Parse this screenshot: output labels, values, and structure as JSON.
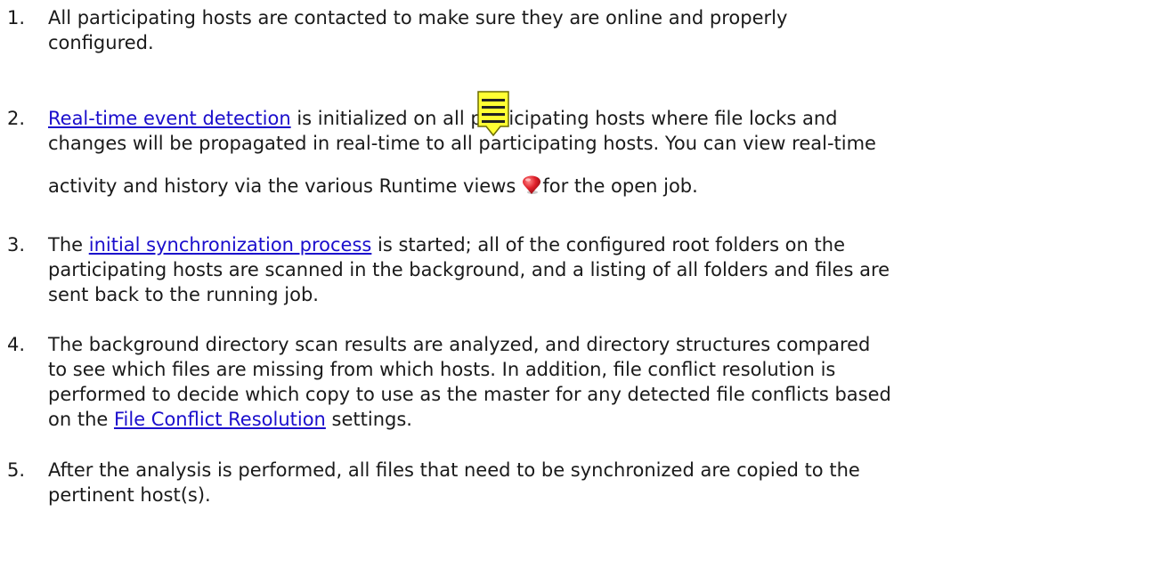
{
  "items": [
    {
      "number": "1.",
      "lines": [
        "All participating hosts are contacted to make sure they are online and properly",
        "configured."
      ]
    },
    {
      "number": "2.",
      "link": "Real-time event detection",
      "line1_rest": " is initialized on all participating hosts where file locks and",
      "line2": "changes will be propagated in real-time to all participating hosts.  You can view real-time",
      "line3_before_icon": "activity and history via the various Runtime views",
      "line3_after_icon": "for the open job."
    },
    {
      "number": "3.",
      "line1_before": "The ",
      "link": "initial synchronization process",
      "line1_after": " is started; all of the configured root folders on the",
      "line2": "participating hosts are scanned in the background, and a listing of all folders and files are",
      "line3": "sent back to the running job."
    },
    {
      "number": "4.",
      "line1": "The background directory scan results are analyzed, and directory structures compared",
      "line2": "to see which files are missing from which hosts.  In addition, file conflict resolution is",
      "line3": "performed to decide which copy to use as the master for any detected file conflicts based",
      "line4_before": "on the ",
      "link": "File Conflict Resolution",
      "line4_after": " settings."
    },
    {
      "number": "5.",
      "line1": "After the analysis is performed, all files that need to be synchronized are copied to the",
      "line2": "pertinent host(s)."
    }
  ],
  "icons": {
    "note": "sticky-note-icon",
    "pin": "map-pin-icon",
    "note_color": "#ffff33",
    "pin_color": "#e0202a",
    "link_color": "#1a0dcc"
  }
}
